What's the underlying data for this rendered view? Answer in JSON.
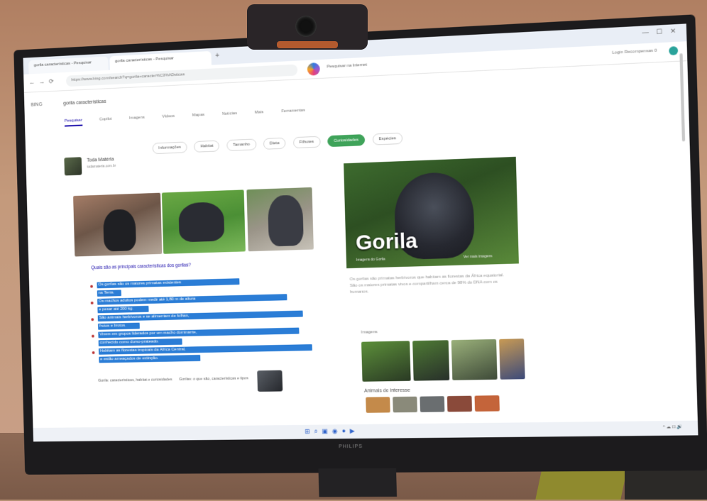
{
  "browser": {
    "tabs": [
      {
        "label": "gorila características - Pesquisar"
      },
      {
        "label": "gorila características - Pesquisar"
      }
    ],
    "new_tab": "+",
    "url": "https://www.bing.com/search?q=gorila+caracter%C3%ADsticas",
    "search_header": "Pesquisar na Internet",
    "user_area": "Login   Recompensas   0",
    "window_controls": [
      "—",
      "☐",
      "✕"
    ]
  },
  "search": {
    "label": "BING",
    "query": "gorila características",
    "filters": [
      "Pesquisar",
      "Copilot",
      "Imagens",
      "Vídeos",
      "Mapas",
      "Notícias",
      "Mais",
      "Ferramentas"
    ],
    "active_filter": "Pesquisar",
    "chips": [
      "Informações",
      "Habitat",
      "Tamanho",
      "Dieta",
      "Filhotes",
      "Curiosidades",
      "Espécies"
    ],
    "active_chip": "Curiosidades"
  },
  "result": {
    "site": "Toda Matéria",
    "site_sub": "todamateria.com.br",
    "question": "Quais são as principais características dos gorilas?",
    "highlighted_lines": [
      "Os gorilas são os maiores primatas existentes",
      "na Terra.",
      "Os machos adultos podem medir até 1,80 m de altura",
      "e pesar até 200 kg.",
      "São animais herbívoros e se alimentam de folhas,",
      "frutos e brotos.",
      "Vivem em grupos liderados por um macho dominante,",
      "conhecido como dorso-prateado.",
      "Habitam as florestas tropicais da África Central,",
      "e estão ameaçados de extinção."
    ],
    "related": [
      "Gorila: características, habitat e curiosidades",
      "Gorilas: o que são, características e tipos"
    ]
  },
  "knowledge_panel": {
    "title": "Gorila",
    "caption": "Imagens do Gorila",
    "credit": "Ver mais imagens",
    "description": "Os gorilas são primatas herbívoros que habitam as florestas da África equatorial. São os maiores primatas vivos e compartilham cerca de 98% do DNA com os humanos.",
    "section": "Imagens",
    "subsection": "Animais de interesse"
  },
  "colors": {
    "accent": "#2b7dd6",
    "chip_active": "#3fa35a",
    "link": "#1a0dab"
  },
  "monitor": {
    "brand": "PHILIPS"
  }
}
